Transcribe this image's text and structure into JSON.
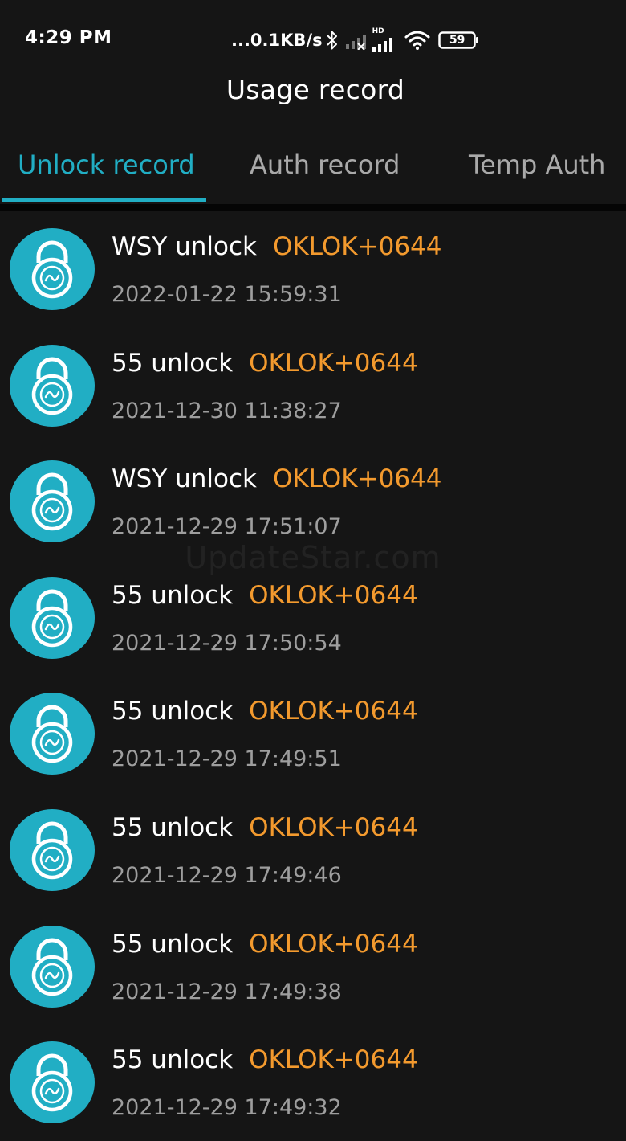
{
  "status_bar": {
    "time": "4:29 PM",
    "network_speed": "...0.1KB/s",
    "network_type": "HD",
    "battery": "59"
  },
  "header": {
    "title": "Usage record"
  },
  "tabs": [
    {
      "label": "Unlock record",
      "active": true
    },
    {
      "label": "Auth record",
      "active": false
    },
    {
      "label": "Temp Auth",
      "active": false
    }
  ],
  "records": [
    {
      "user": "WSY unlock",
      "lock": "OKLOK+0644",
      "time": "2022-01-22 15:59:31"
    },
    {
      "user": "55 unlock",
      "lock": "OKLOK+0644",
      "time": "2021-12-30 11:38:27"
    },
    {
      "user": "WSY unlock",
      "lock": "OKLOK+0644",
      "time": "2021-12-29 17:51:07"
    },
    {
      "user": "55 unlock",
      "lock": "OKLOK+0644",
      "time": "2021-12-29 17:50:54"
    },
    {
      "user": "55 unlock",
      "lock": "OKLOK+0644",
      "time": "2021-12-29 17:49:51"
    },
    {
      "user": "55 unlock",
      "lock": "OKLOK+0644",
      "time": "2021-12-29 17:49:46"
    },
    {
      "user": "55 unlock",
      "lock": "OKLOK+0644",
      "time": "2021-12-29 17:49:38"
    },
    {
      "user": "55 unlock",
      "lock": "OKLOK+0644",
      "time": "2021-12-29 17:49:32"
    }
  ],
  "watermark": "UpdateStar.com",
  "colors": {
    "accent": "#21aec4",
    "lock_name": "#f39a2e",
    "background": "#151515",
    "inactive_tab": "#a9a9a9",
    "timestamp": "#9e9e9e"
  },
  "icons": {
    "record_icon": "padlock-icon",
    "status": [
      "bluetooth-icon",
      "cell-signal-icon",
      "wifi-icon",
      "battery-icon"
    ]
  }
}
